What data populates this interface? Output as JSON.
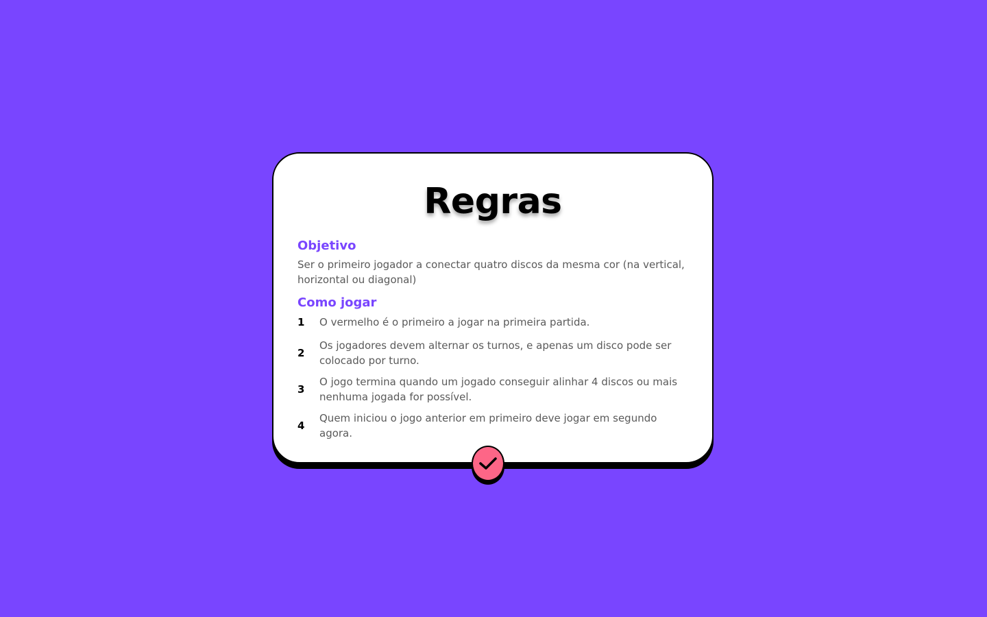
{
  "page": {
    "title": "Regras"
  },
  "objective": {
    "heading": "Objetivo",
    "text": "Ser o primeiro jogador a conectar quatro discos da mesma cor (na vertical, horizontal ou diagonal)"
  },
  "how_to_play": {
    "heading": "Como jogar",
    "rules": [
      {
        "number": "1",
        "text": "O vermelho é o primeiro a jogar na primeira partida."
      },
      {
        "number": "2",
        "text": "Os jogadores devem alternar os turnos, e apenas um disco pode ser colocado por turno."
      },
      {
        "number": "3",
        "text": "O jogo termina quando um jogado conseguir alinhar 4 discos ou mais nenhuma jogada for possível."
      },
      {
        "number": "4",
        "text": "Quem iniciou o jogo anterior em primeiro deve jogar em segundo agora."
      }
    ]
  },
  "confirm_button": {
    "icon": "check-icon"
  },
  "colors": {
    "background": "#7945FF",
    "accent": "#7945FF",
    "button": "#FD6687",
    "card": "#FFFFFF",
    "border": "#000000"
  }
}
